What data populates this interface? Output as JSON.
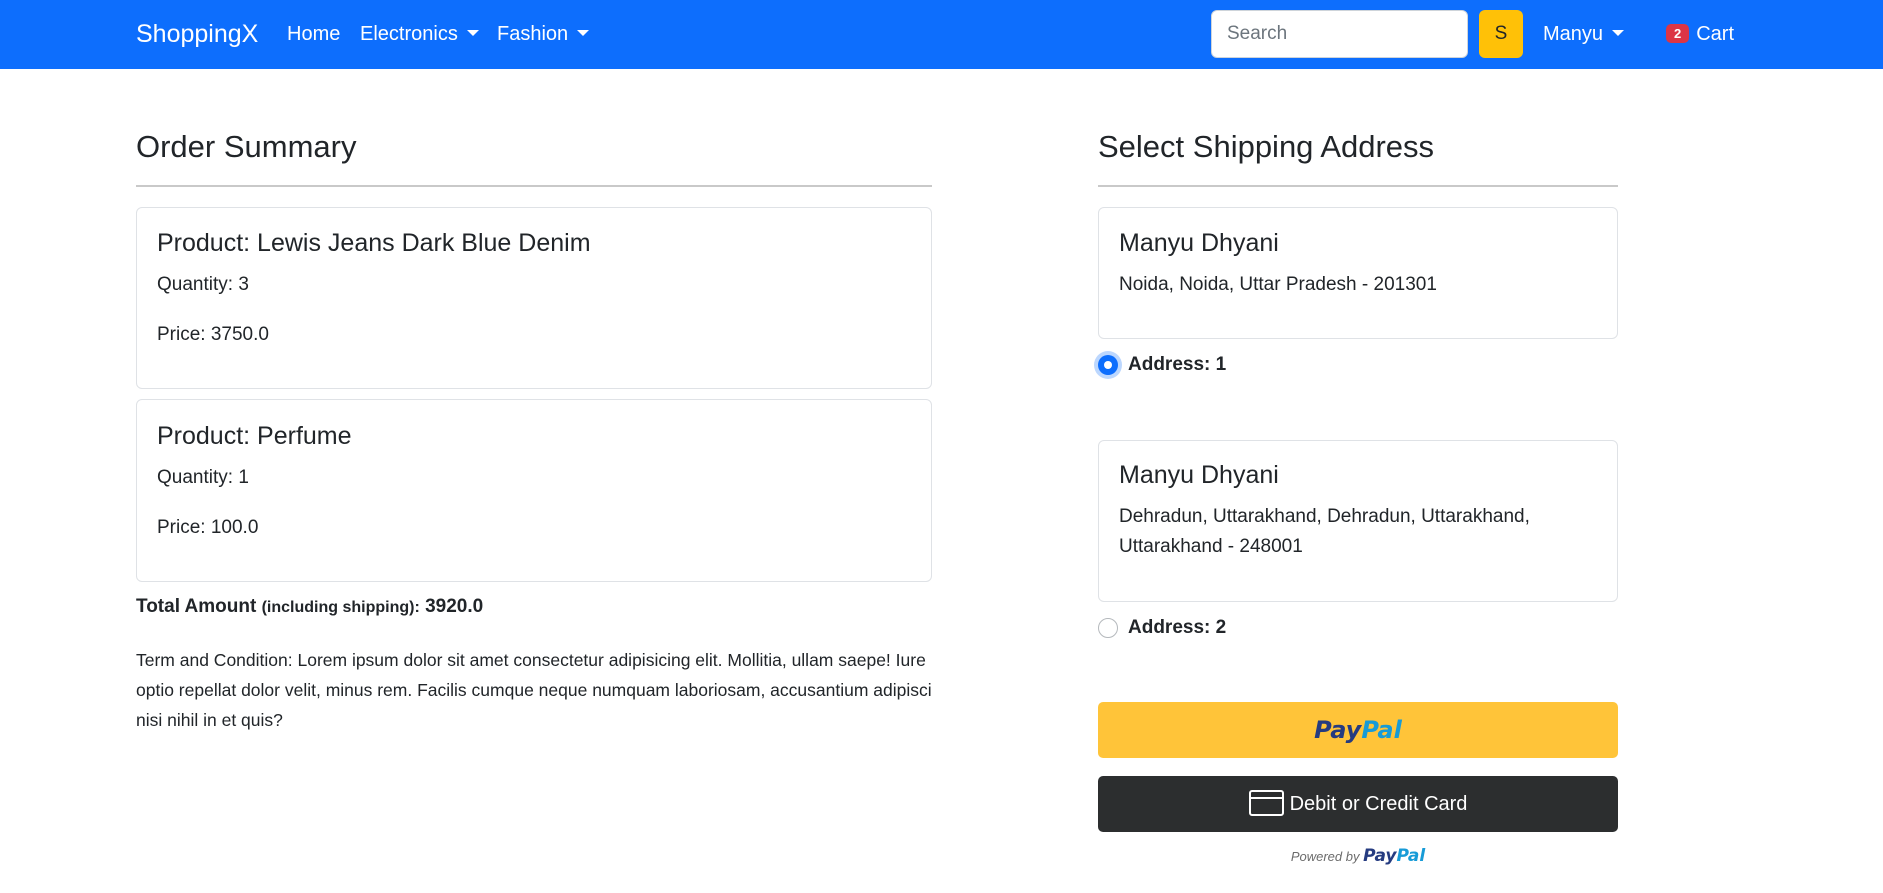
{
  "nav": {
    "brand": "ShoppingX",
    "home": "Home",
    "electronics": "Electronics",
    "fashion": "Fashion",
    "search_placeholder": "Search",
    "search_button": "S",
    "user": "Manyu",
    "cart_count": "2",
    "cart": "Cart"
  },
  "order": {
    "title": "Order Summary",
    "items": [
      {
        "product": "Product: Lewis Jeans Dark Blue Denim",
        "quantity": "Quantity: 3",
        "price": "Price: 3750.0"
      },
      {
        "product": "Product: Perfume",
        "quantity": "Quantity: 1",
        "price": "Price: 100.0"
      }
    ],
    "total_label": "Total Amount",
    "total_note": "(including shipping):",
    "total_value": "3920.0",
    "terms": "Term and Condition: Lorem ipsum dolor sit amet consectetur adipisicing elit. Mollitia, ullam saepe! Iure optio repellat dolor velit, minus rem. Facilis cumque neque numquam laboriosam, accusantium adipisci nisi nihil in et quis?"
  },
  "shipping": {
    "title": "Select Shipping Address",
    "addresses": [
      {
        "name": "Manyu Dhyani",
        "line1": "Noida, Noida, Uttar Pradesh - 201301",
        "line2": "",
        "label": "Address: 1",
        "selected": true
      },
      {
        "name": "Manyu Dhyani",
        "line1": "Dehradun, Uttarakhand, Dehradun, Uttarakhand,",
        "line2": "Uttarakhand - 248001",
        "label": "Address: 2",
        "selected": false
      }
    ]
  },
  "payment": {
    "paypal_part1": "Pay",
    "paypal_part2": "Pal",
    "card_label": "Debit or Credit Card",
    "powered_by": "Powered by",
    "powered_part1": "Pay",
    "powered_part2": "Pal"
  },
  "colors": {
    "navbar": "#0d6efd",
    "search_button": "#ffc107",
    "badge": "#dc3545",
    "paypal_button": "#ffc439",
    "card_button": "#2c2e2f"
  }
}
